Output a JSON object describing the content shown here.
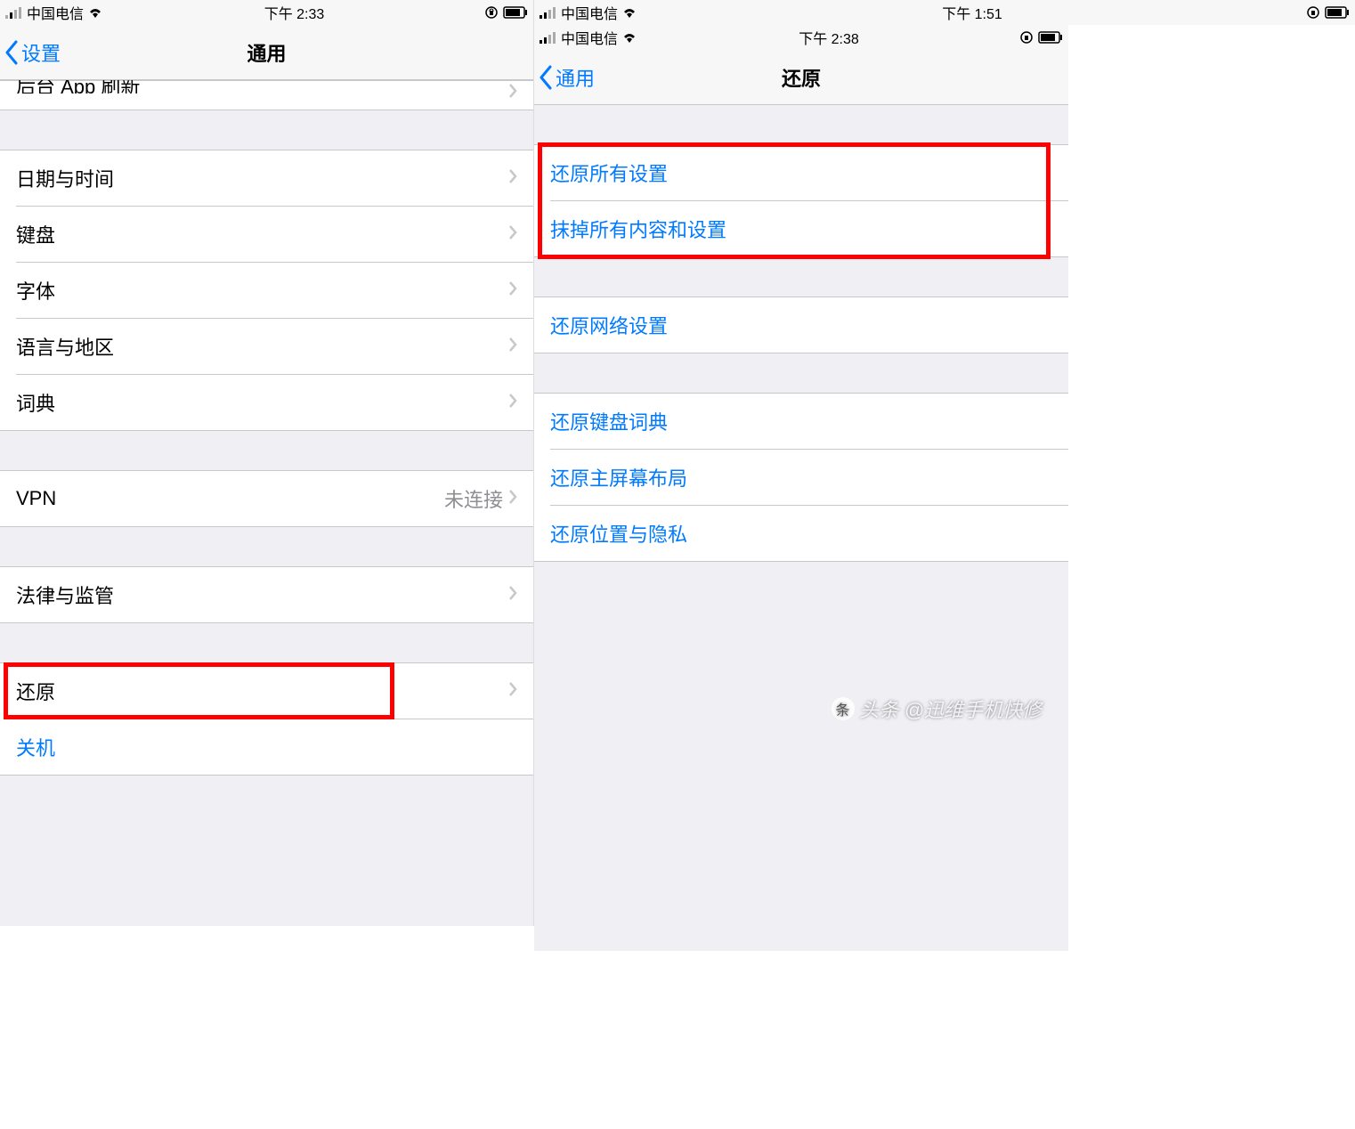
{
  "left": {
    "status": {
      "carrier": "中国电信",
      "time": "下午 2:33"
    },
    "nav": {
      "back": "设置",
      "title": "通用"
    },
    "rowCut": "后台 App 刷新",
    "group1": [
      "日期与时间",
      "键盘",
      "字体",
      "语言与地区",
      "词典"
    ],
    "vpn": {
      "label": "VPN",
      "value": "未连接"
    },
    "legal": "法律与监管",
    "reset": "还原",
    "shutdown": "关机"
  },
  "right": {
    "statusOuter": {
      "carrier": "中国电信",
      "time": "下午 1:51"
    },
    "statusInner": {
      "carrier": "中国电信",
      "time": "下午 2:38"
    },
    "nav": {
      "back": "通用",
      "title": "还原"
    },
    "group1": [
      "还原所有设置",
      "抹掉所有内容和设置"
    ],
    "group2": [
      "还原网络设置"
    ],
    "group3": [
      "还原键盘词典",
      "还原主屏幕布局",
      "还原位置与隐私"
    ]
  },
  "watermark": "头条 @迅维手机快修"
}
